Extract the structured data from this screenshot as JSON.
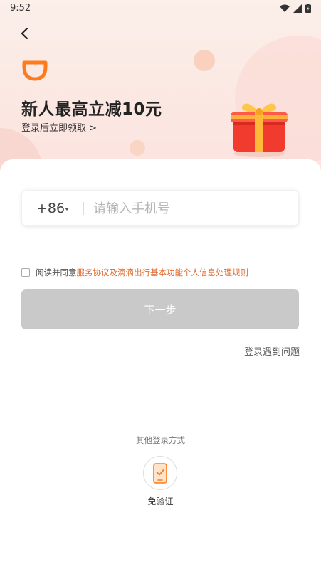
{
  "status_bar": {
    "time": "9:52",
    "icons": [
      "wifi-icon",
      "signal-icon",
      "battery-icon"
    ]
  },
  "header": {
    "back_icon": "chevron-left-icon",
    "brand_icon": "didi-logo-icon",
    "headline": "新人最高立减10元",
    "subline": "登录后立即领取 >",
    "gift_icon": "gift-box-icon"
  },
  "login": {
    "country_code": "+86",
    "phone_placeholder": "请输入手机号",
    "agreement_prefix": "阅读并同意",
    "agreement_link": "服务协议及滴滴出行基本功能个人信息处理规则",
    "next_label": "下一步",
    "trouble_label": "登录遇到问题"
  },
  "other_login": {
    "title": "其他登录方式",
    "option_label": "免验证",
    "option_icon": "phone-check-icon"
  },
  "colors": {
    "accent": "#ff7a1a",
    "link": "#e26a2c",
    "button_disabled": "#c9c9c9"
  }
}
